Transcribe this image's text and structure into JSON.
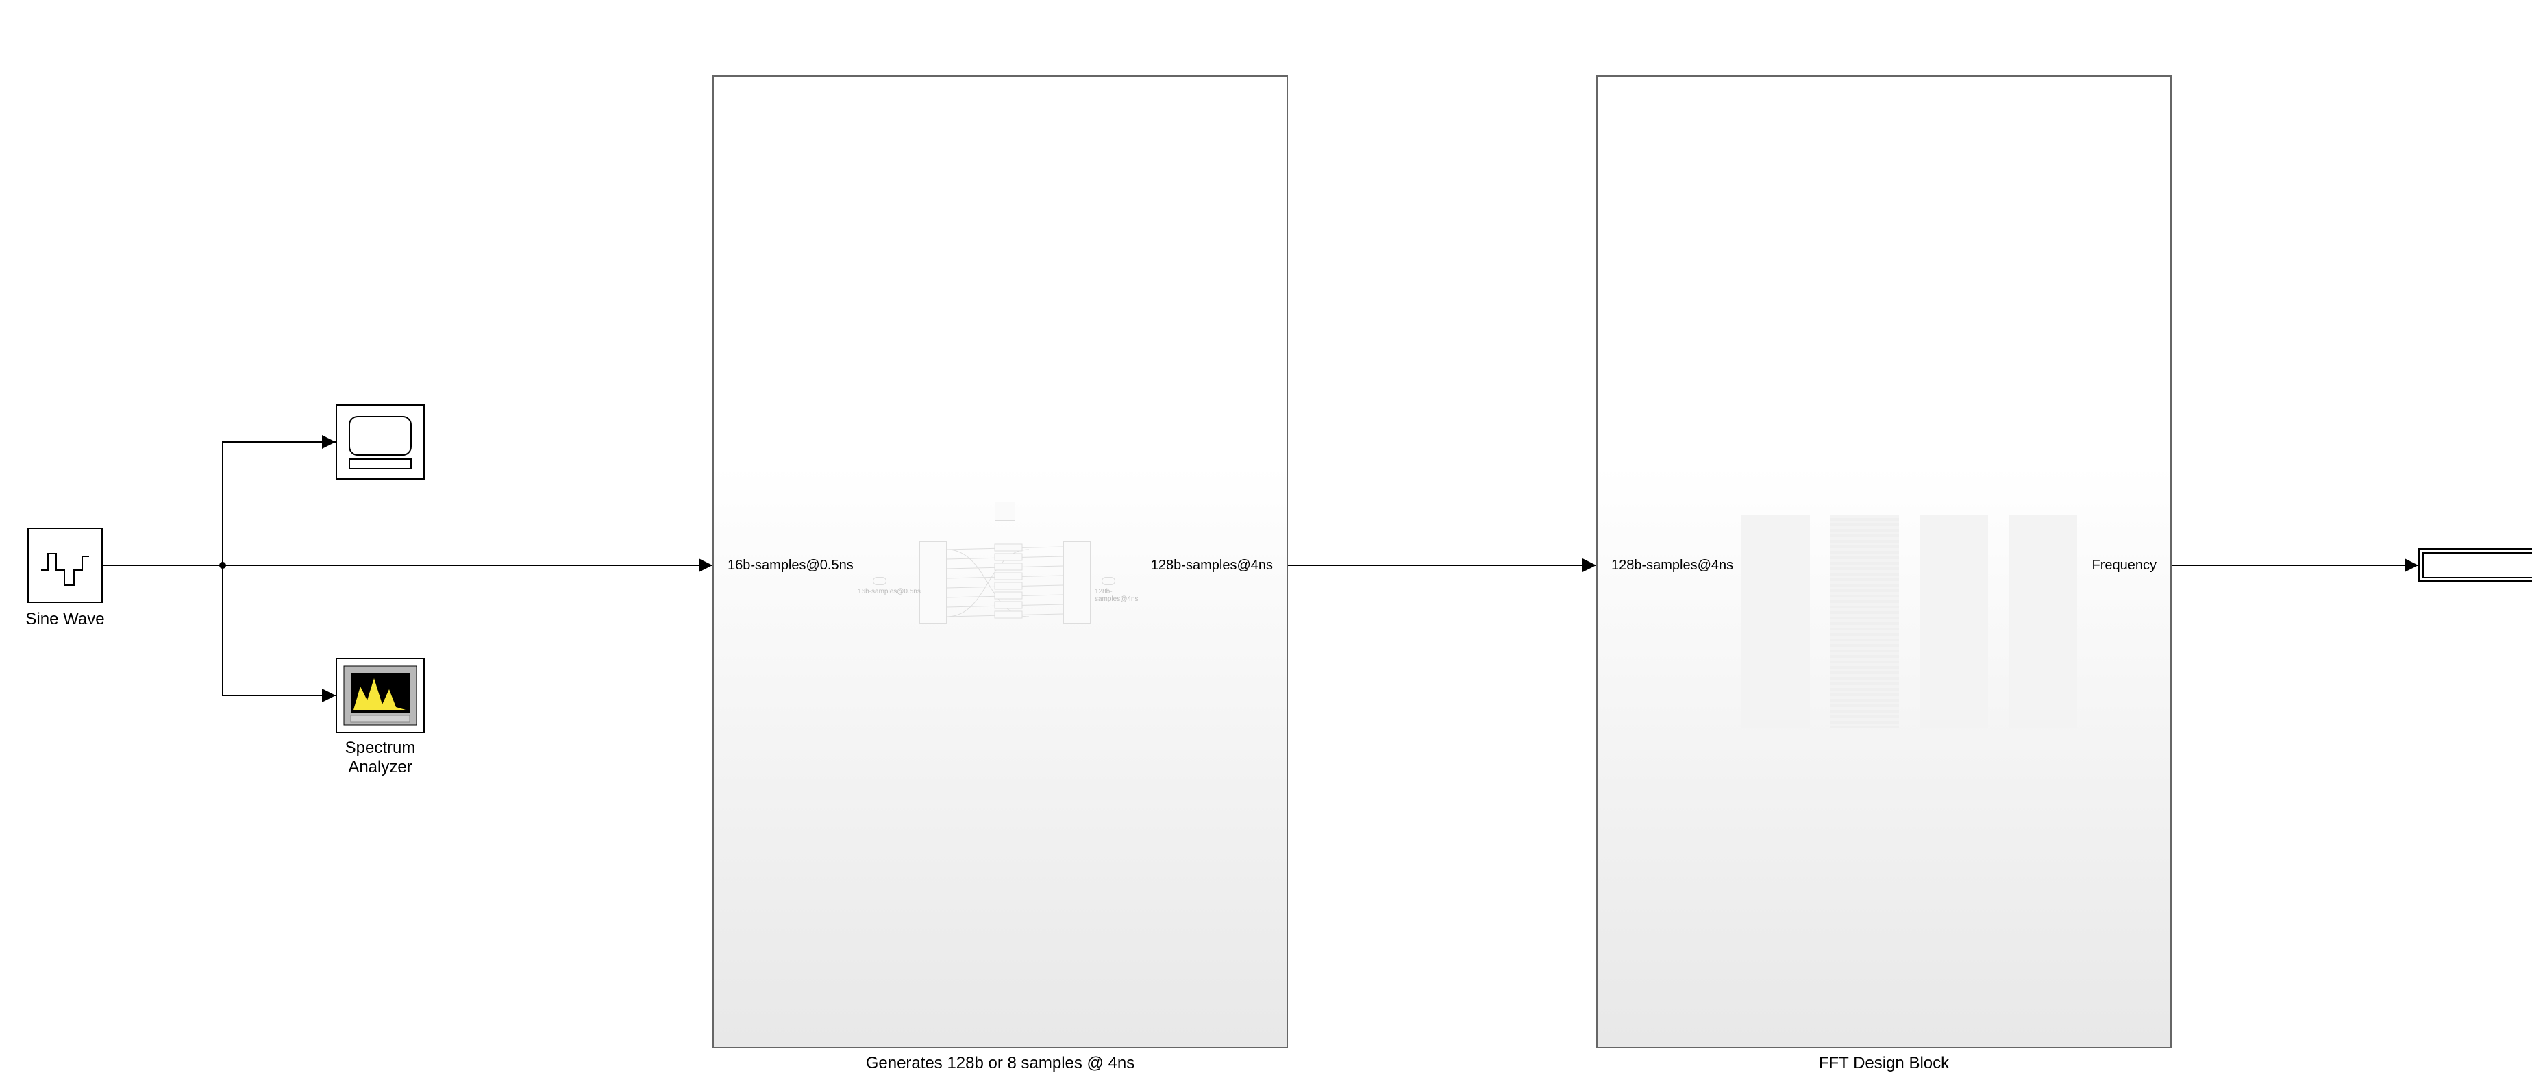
{
  "blocks": {
    "sine_wave": {
      "label": "Sine Wave"
    },
    "scope": {
      "label": ""
    },
    "spectrum_analyzer": {
      "label_line1": "Spectrum",
      "label_line2": "Analyzer"
    },
    "subsystem1": {
      "label": "Generates 128b or 8 samples @ 4ns",
      "port_in": "16b-samples@0.5ns",
      "port_out": "128b-samples@4ns"
    },
    "subsystem2": {
      "label": "FFT Design Block",
      "port_in": "128b-samples@4ns",
      "port_out": "Frequency"
    },
    "display": {
      "label": ""
    }
  }
}
